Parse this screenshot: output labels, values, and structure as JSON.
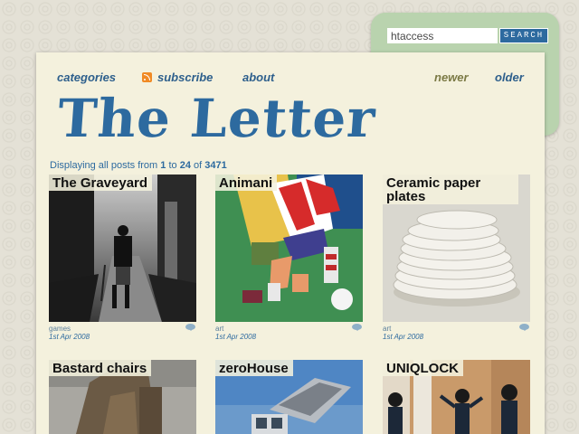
{
  "search": {
    "value": "htaccess",
    "button_label": "SEARCH"
  },
  "nav": {
    "categories": "categories",
    "subscribe": "subscribe",
    "about": "about",
    "newer": "newer",
    "older": "older"
  },
  "site": {
    "title": "The Letter"
  },
  "pagination": {
    "prefix": "Displaying all posts from",
    "from": "1",
    "to_word": "to",
    "to": "24",
    "of_word": "of",
    "total": "3471"
  },
  "posts": [
    {
      "title": "The Graveyard",
      "category": "games",
      "date": "1st Apr 2008"
    },
    {
      "title": "Animani",
      "category": "art",
      "date": "1st Apr 2008"
    },
    {
      "title": "Ceramic paper plates",
      "category": "art",
      "date": "1st Apr 2008"
    },
    {
      "title": "Bastard chairs"
    },
    {
      "title": "zeroHouse"
    },
    {
      "title": "UNIQLOCK"
    }
  ],
  "colors": {
    "accent": "#2d6a9f",
    "search_panel": "#b9d3ae",
    "paper": "#f4f1dd",
    "rss": "#f08a24"
  },
  "icons": [
    "rss-icon",
    "comment-icon"
  ]
}
